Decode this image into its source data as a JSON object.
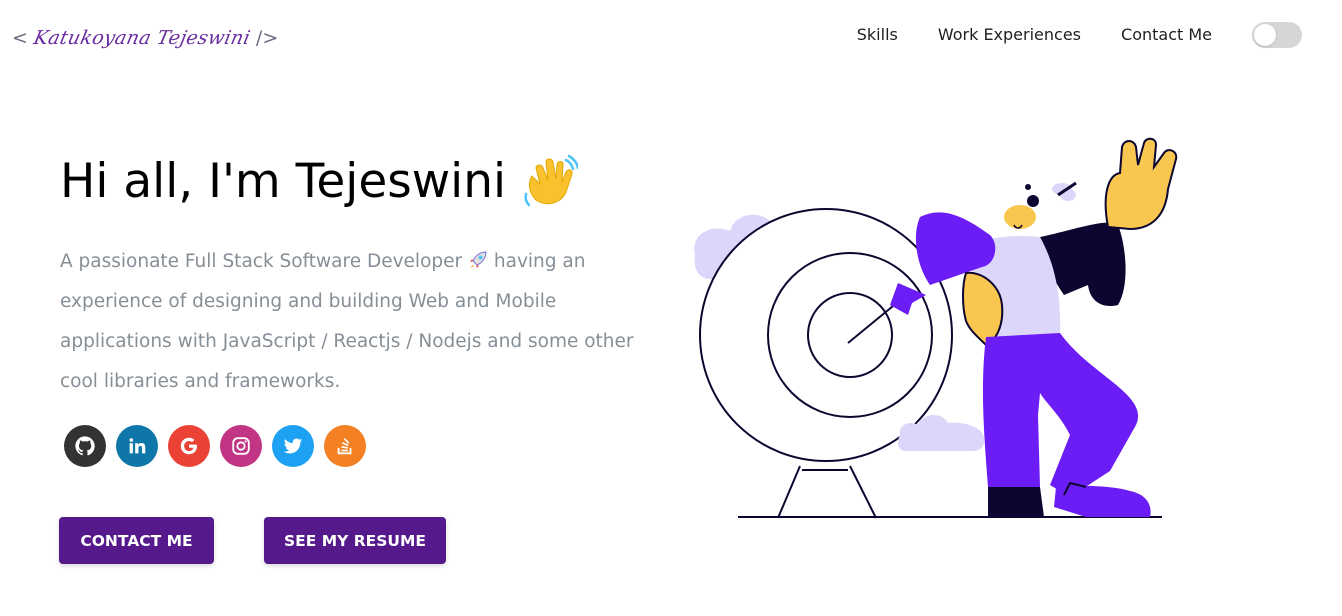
{
  "header": {
    "logo_open": "<",
    "logo_name": "Katukoyana Tejeswini",
    "logo_close": "/>",
    "nav": [
      "Skills",
      "Work Experiences",
      "Contact Me"
    ],
    "theme_toggle": "off"
  },
  "hero": {
    "title": "Hi all, I'm Tejeswini",
    "subtitle_part1": "A passionate Full Stack Software Developer",
    "subtitle_part2": "having an experience of designing and building Web and Mobile applications with JavaScript / Reactjs / Nodejs and some other cool libraries and frameworks.",
    "buttons": {
      "contact": "CONTACT ME",
      "resume": "SEE MY RESUME"
    }
  },
  "socials": [
    {
      "icon": "github-icon",
      "color": "#333333"
    },
    {
      "icon": "linkedin-icon",
      "color": "#0e76a8"
    },
    {
      "icon": "google-icon",
      "color": "#ea4335"
    },
    {
      "icon": "instagram-icon",
      "color": "#c13584"
    },
    {
      "icon": "twitter-icon",
      "color": "#1da1f2"
    },
    {
      "icon": "stackoverflow-icon",
      "color": "#f48024"
    }
  ],
  "colors": {
    "accent": "#55198b",
    "figure_purple": "#6c1cf5",
    "lavender": "#ddd6fb",
    "skin": "#f9c74f",
    "subtitle_gray": "#868e96"
  }
}
